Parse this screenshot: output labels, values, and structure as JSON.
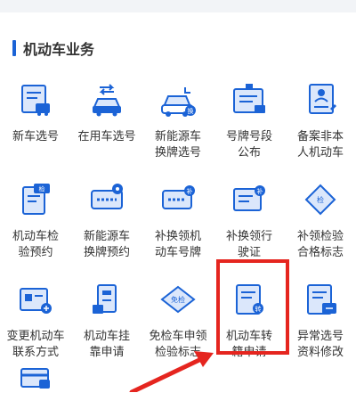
{
  "section": {
    "title": "机动车业务"
  },
  "colors": {
    "accent": "#1b63d6",
    "highlight": "#e5251f",
    "icon_light": "#dbe7fb"
  },
  "tiles": [
    {
      "label": "新车选号",
      "icon": "new-car-plate-icon"
    },
    {
      "label": "在用车选号",
      "icon": "in-use-car-plate-icon"
    },
    {
      "label": "新能源车\n换牌选号",
      "icon": "new-energy-car-icon"
    },
    {
      "label": "号牌号段\n公布",
      "icon": "plate-range-board-icon"
    },
    {
      "label": "备案非本\n人机动车",
      "icon": "record-person-icon"
    },
    {
      "label": "机动车检\n验预约",
      "icon": "inspection-booking-icon"
    },
    {
      "label": "新能源车\n换牌预约",
      "icon": "new-energy-plate-booking-icon"
    },
    {
      "label": "补换领机\n动车号牌",
      "icon": "plate-replace-icon"
    },
    {
      "label": "补换领行\n驶证",
      "icon": "license-replace-icon"
    },
    {
      "label": "补领检验\n合格标志",
      "icon": "inspection-mark-replace-icon"
    },
    {
      "label": "变更机动车\n联系方式",
      "icon": "contact-change-icon"
    },
    {
      "label": "机动车挂\n靠申请",
      "icon": "affiliation-apply-icon"
    },
    {
      "label": "免检车申领\n检验标志",
      "icon": "exempt-mark-icon"
    },
    {
      "label": "机动车转\n籍申请",
      "icon": "transfer-registration-icon"
    },
    {
      "label": "异常选号\n资料修改",
      "icon": "abnormal-plate-edit-icon"
    },
    {
      "label": "",
      "icon": "card-icon"
    }
  ],
  "icon_badges": {
    "inspection": "检",
    "replace": "补",
    "transfer": "转",
    "change": "换",
    "exempt": "免检"
  }
}
